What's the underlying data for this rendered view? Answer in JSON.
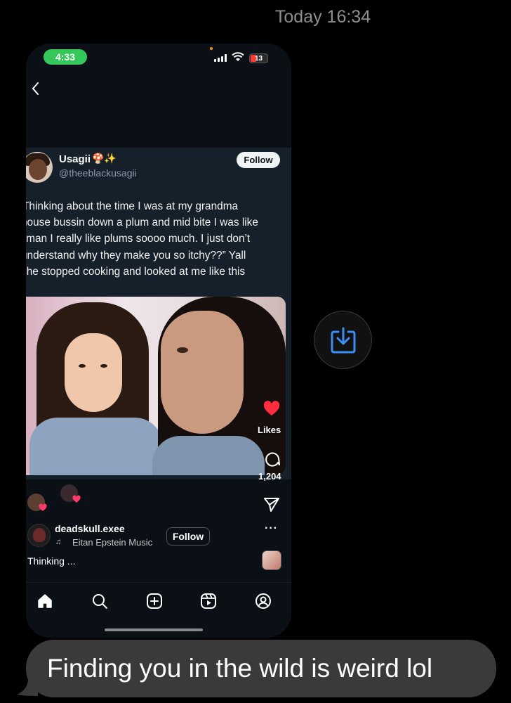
{
  "thread": {
    "timestamp": "Today 16:34"
  },
  "screenshot": {
    "status_bar": {
      "time": "4:33",
      "battery": "13"
    },
    "tweet": {
      "name": "Usagii",
      "name_emojis": "🍄✨",
      "handle": "@theeblackusagii",
      "follow_label": "Follow",
      "lines": [
        "Thinking about the time I was at my grandma",
        "house bussin down a plum and mid bite I was like",
        "“man I really like plums soooo much. I just don’t",
        "understand why they make you so itchy??” Yall",
        "she stopped cooking and looked at me like this"
      ]
    },
    "reel": {
      "likes_label": "Likes",
      "comment_count": "1,204",
      "username": "deadskull.exee",
      "music": "Eitan Epstein Music",
      "follow_label": "Follow",
      "caption": "Thinking ...",
      "more": "···"
    },
    "nav": [
      "home-icon",
      "search-icon",
      "create-icon",
      "reels-icon",
      "profile-icon"
    ]
  },
  "message": {
    "text": "Finding you in the wild is weird lol"
  },
  "colors": {
    "accent_blue": "#3a8ef6",
    "bubble_gray": "#3a3a3c",
    "heart_red": "#ff2d3f",
    "pill_green": "#34c759"
  }
}
